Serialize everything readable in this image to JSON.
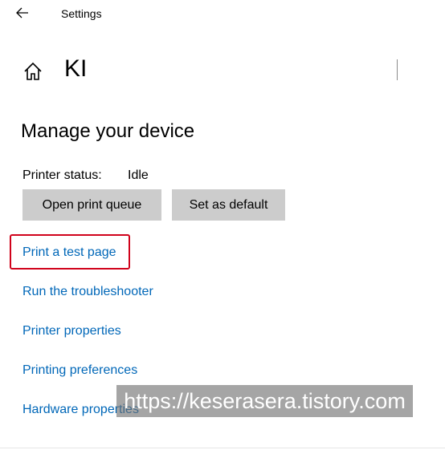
{
  "header": {
    "app_title": "Settings",
    "back_icon": "back-arrow-icon"
  },
  "page": {
    "home_icon": "home-icon",
    "title": "KI"
  },
  "section": {
    "heading": "Manage your device",
    "status_label": "Printer status:",
    "status_value": "Idle"
  },
  "buttons": {
    "open_queue": "Open print queue",
    "set_default": "Set as default"
  },
  "links": {
    "test_page": "Print a test page",
    "troubleshooter": "Run the troubleshooter",
    "printer_properties": "Printer properties",
    "printing_preferences": "Printing preferences",
    "hardware_properties": "Hardware properties"
  },
  "watermark": {
    "text": "https://keserasera.tistory.com"
  },
  "colors": {
    "link": "#0067b8",
    "button_bg": "#cccccc",
    "highlight": "#d0021b"
  }
}
